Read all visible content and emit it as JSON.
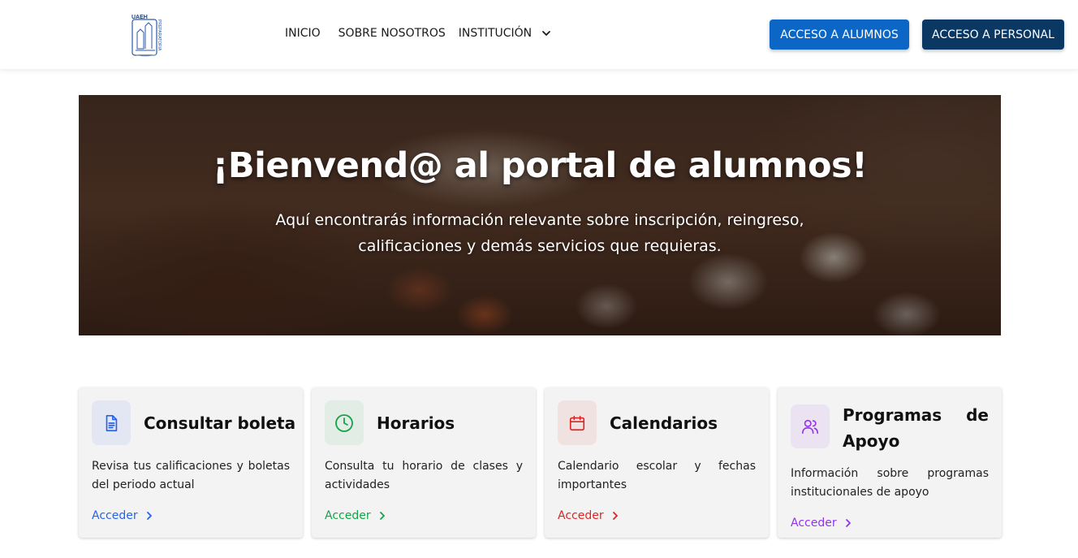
{
  "header": {
    "logo": {
      "text": "UAEH",
      "subtext": "PREPARATORIA",
      "icon": "uaeh-logo-icon"
    },
    "nav": {
      "inicio": "INICIO",
      "sobre": "SOBRE NOSOTROS",
      "institucion": "INSTITUCIÓN"
    },
    "buttons": {
      "alumnos": "ACCESO A ALUMNOS",
      "personal": "ACCESO A PERSONAL"
    }
  },
  "hero": {
    "title": "¡Bienvend@ al portal de alumnos!",
    "subtitle": "Aquí encontrarás información relevante sobre inscripción, reingreso, calificaciones y demás servicios que requieras."
  },
  "cards": [
    {
      "title": "Consultar boleta",
      "description": "Revisa tus calificaciones y boletas del periodo actual",
      "link": "Acceder",
      "icon": "document-icon",
      "color": "#2563eb",
      "bg": "#e3e7f3"
    },
    {
      "title": "Horarios",
      "description": "Consulta tu horario de clases y actividades",
      "link": "Acceder",
      "icon": "clock-icon",
      "color": "#16a34a",
      "bg": "#e2ede5"
    },
    {
      "title": "Calendarios",
      "description": "Calendario escolar y fechas importantes",
      "link": "Acceder",
      "icon": "calendar-icon",
      "color": "#dc2626",
      "bg": "#f1e2e2"
    },
    {
      "title_line1": "Programas de",
      "title_line2": "Apoyo",
      "description": "Información sobre programas institucionales de apoyo",
      "link": "Acceder",
      "icon": "users-icon",
      "color": "#9333ea",
      "bg": "#ebe3f1"
    }
  ],
  "colors": {
    "primary": "#0b66c6",
    "secondary": "#0b3763"
  }
}
